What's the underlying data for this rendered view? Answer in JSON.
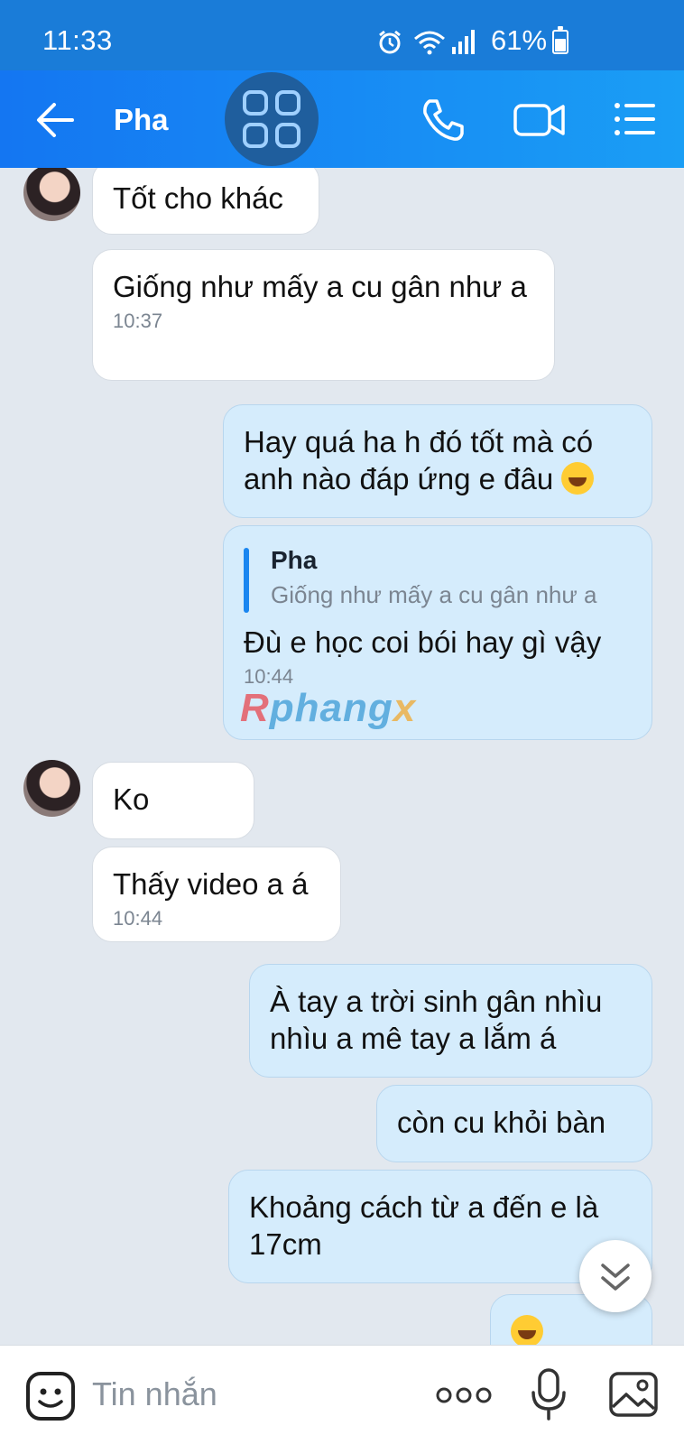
{
  "status": {
    "time": "11:33",
    "battery": "61%",
    "battery_level": 0.61
  },
  "header": {
    "title": "Pha"
  },
  "messages": {
    "m1": {
      "text": "Tốt cho khác"
    },
    "m2": {
      "text": "Giống như mấy a cu gân như a",
      "time": "10:37"
    },
    "m3": {
      "text": "Hay quá ha h đó tốt mà có anh nào đáp ứng e đâu"
    },
    "m4": {
      "quote_name": "Pha",
      "quote_text": "Giống như mấy a cu gân như a",
      "text": "Đù e học coi bói hay gì vậy",
      "time": "10:44"
    },
    "m5": {
      "text": "Ko"
    },
    "m6": {
      "text": "Thấy video a á",
      "time": "10:44"
    },
    "m7": {
      "text": "À tay a trời sinh gân nhìu nhìu a mê tay a lắm á"
    },
    "m8": {
      "text": "còn cu khỏi bàn"
    },
    "m9": {
      "text": "Khoảng cách từ a đến e là 17cm"
    }
  },
  "watermark": {
    "first": "R",
    "middle": "phang",
    "last": "x"
  },
  "composer": {
    "placeholder": "Tin nhắn"
  }
}
